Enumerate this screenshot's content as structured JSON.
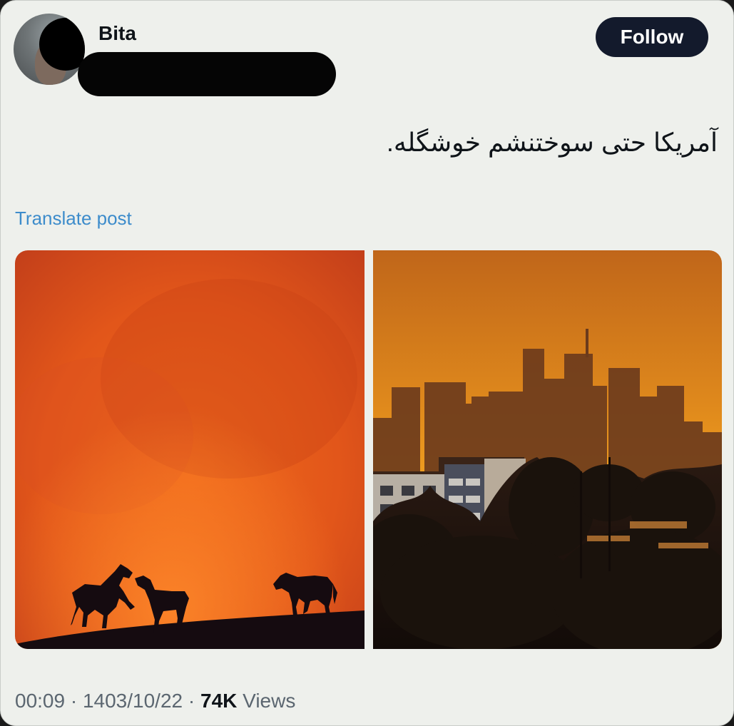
{
  "post": {
    "author_name": "Bita",
    "follow_label": "Follow",
    "text": "آمریکا حتی سوختنشم خوشگله.",
    "translate_label": "Translate post",
    "time": "00:09",
    "separator": "·",
    "date": "1403/10/22",
    "views_count": "74K",
    "views_label": "Views"
  },
  "media": [
    {
      "name": "horses-fire-photo"
    },
    {
      "name": "city-skyline-photo"
    }
  ],
  "colors": {
    "background": "#eef0ec",
    "follow_button": "#131a2c",
    "link": "#3d8ccb",
    "secondary_text": "#5b6670"
  }
}
